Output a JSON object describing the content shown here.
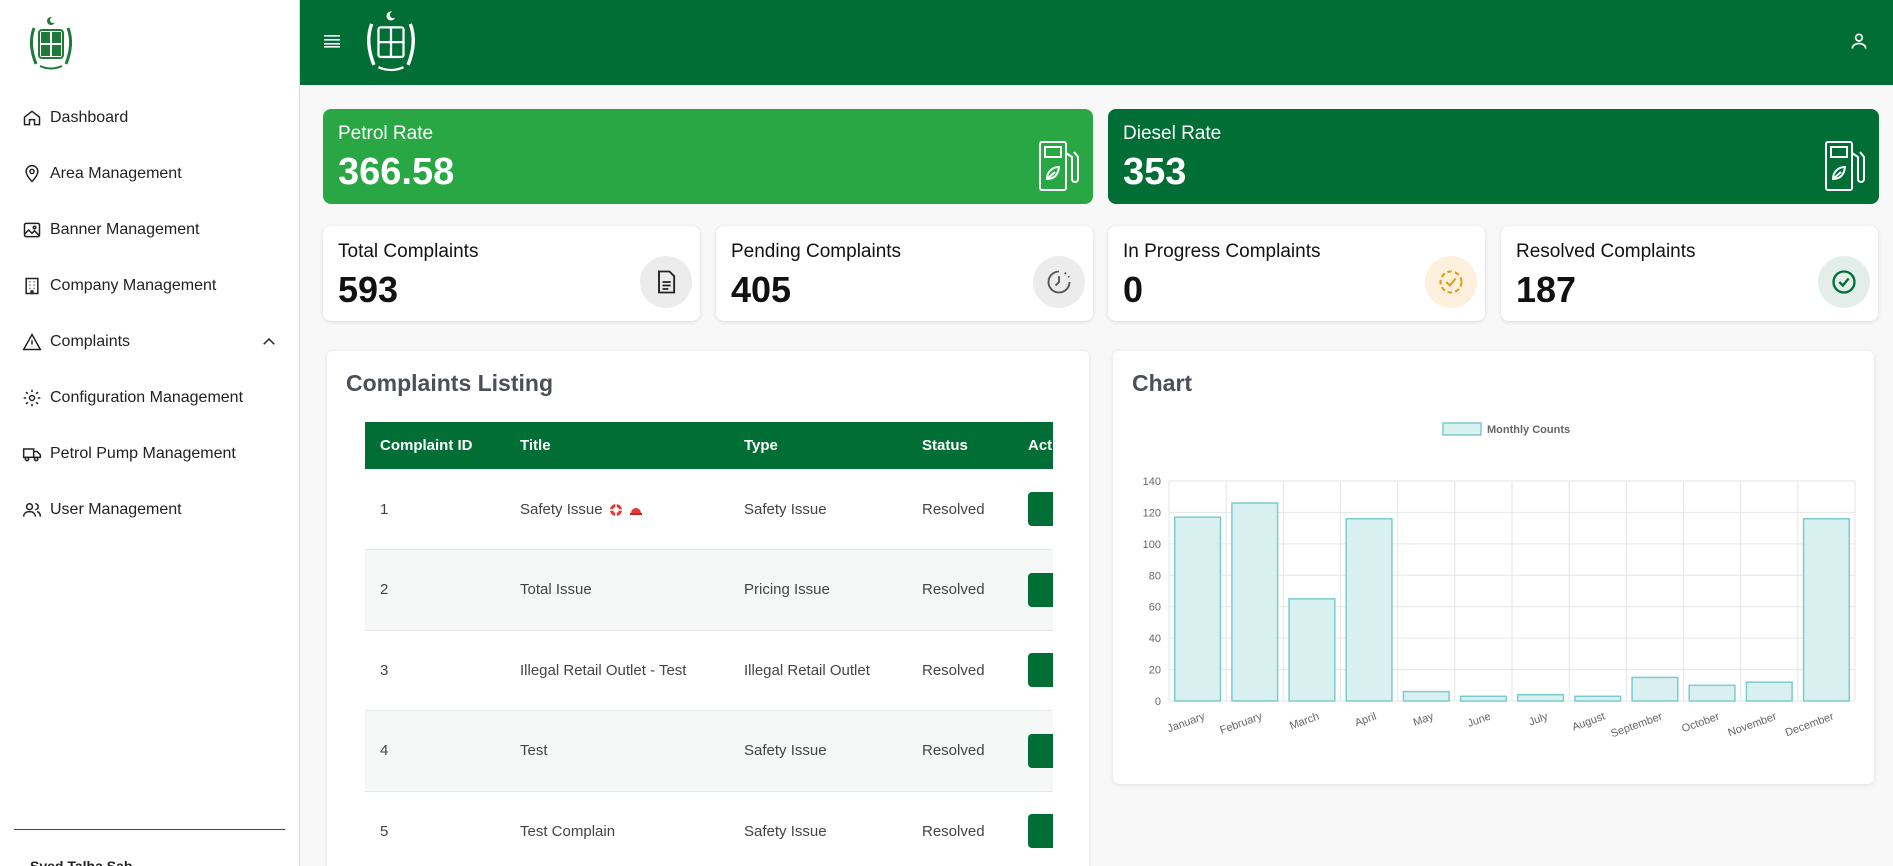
{
  "sidebar": {
    "items": [
      {
        "label": "Dashboard",
        "icon": "home-icon"
      },
      {
        "label": "Area Management",
        "icon": "map-pin-icon"
      },
      {
        "label": "Banner Management",
        "icon": "image-icon"
      },
      {
        "label": "Company Management",
        "icon": "building-icon"
      },
      {
        "label": "Complaints",
        "icon": "warning-icon"
      },
      {
        "label": "Configuration Management",
        "icon": "gear-icon"
      },
      {
        "label": "Petrol Pump Management",
        "icon": "truck-icon"
      },
      {
        "label": "User Management",
        "icon": "users-icon"
      }
    ],
    "footer_text": "Syed Talha Sab..."
  },
  "rates": {
    "petrol": {
      "label": "Petrol Rate",
      "value": "366.58",
      "color": "#29a744"
    },
    "diesel": {
      "label": "Diesel Rate",
      "value": "353",
      "color": "#006e35"
    }
  },
  "stats": [
    {
      "label": "Total Complaints",
      "value": "593",
      "icon": "document-icon"
    },
    {
      "label": "Pending Complaints",
      "value": "405",
      "icon": "clock-icon"
    },
    {
      "label": "In Progress Complaints",
      "value": "0",
      "icon": "progress-check-icon"
    },
    {
      "label": "Resolved Complaints",
      "value": "187",
      "icon": "check-circle-icon"
    }
  ],
  "complaints": {
    "title": "Complaints Listing",
    "columns": [
      "Complaint ID",
      "Title",
      "Type",
      "Status",
      "Acti"
    ],
    "rows": [
      {
        "id": "1",
        "title": "Safety Issue",
        "type": "Safety Issue",
        "status": "Resolved"
      },
      {
        "id": "2",
        "title": "Total Issue",
        "type": "Pricing Issue",
        "status": "Resolved"
      },
      {
        "id": "3",
        "title": "Illegal Retail Outlet - Test",
        "type": "Illegal Retail Outlet",
        "status": "Resolved"
      },
      {
        "id": "4",
        "title": "Test",
        "type": "Safety Issue",
        "status": "Resolved"
      },
      {
        "id": "5",
        "title": "Test Complain",
        "type": "Safety Issue",
        "status": "Resolved"
      }
    ]
  },
  "chart_panel": {
    "title": "Chart"
  },
  "chart_data": {
    "type": "bar",
    "categories": [
      "January",
      "February",
      "March",
      "April",
      "May",
      "June",
      "July",
      "August",
      "September",
      "October",
      "November",
      "December"
    ],
    "series": [
      {
        "name": "Monthly Counts",
        "values": [
          117,
          126,
          65,
          116,
          6,
          3,
          4,
          3,
          15,
          10,
          12,
          116
        ]
      }
    ],
    "ylim": [
      0,
      140
    ],
    "yticks": [
      0,
      20,
      40,
      60,
      80,
      100,
      120,
      140
    ],
    "grid": true,
    "legend": "top",
    "bar_fill": "#d8f0f0",
    "bar_stroke": "#7cccce"
  },
  "colors": {
    "brand": "#006e35",
    "accent": "#29a744"
  }
}
